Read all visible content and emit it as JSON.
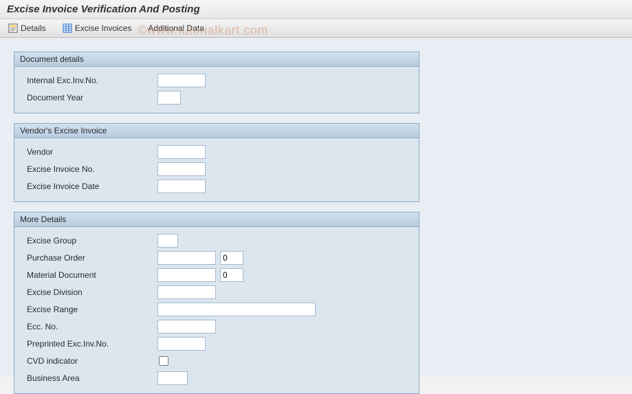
{
  "title": "Excise Invoice Verification And Posting",
  "watermark": "©www.tutorialkart.com",
  "toolbar": {
    "details": "Details",
    "invoices": "Excise Invoices",
    "additional": "Additional Data"
  },
  "groups": {
    "doc": {
      "title": "Document details",
      "fields": {
        "internal_no": "Internal Exc.Inv.No.",
        "doc_year": "Document Year"
      }
    },
    "vendor": {
      "title": "Vendor's Excise Invoice",
      "fields": {
        "vendor": "Vendor",
        "excise_no": "Excise Invoice No.",
        "excise_date": "Excise Invoice Date"
      }
    },
    "more": {
      "title": "More Details",
      "fields": {
        "excise_group": "Excise Group",
        "po": "Purchase Order",
        "po_item": "0",
        "mat_doc": "Material Document",
        "mat_item": "0",
        "division": "Excise Division",
        "range": "Excise Range",
        "ecc": "Ecc. No.",
        "preprinted": "Preprinted Exc.Inv.No.",
        "cvd": "CVD indicator",
        "biz_area": "Business Area"
      }
    }
  }
}
